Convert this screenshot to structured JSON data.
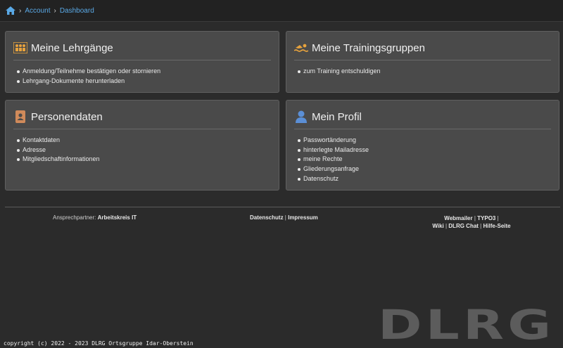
{
  "breadcrumb": {
    "items": [
      "Account",
      "Dashboard"
    ]
  },
  "cards": [
    {
      "title": "Meine Lehrgänge",
      "icon": "group-icon",
      "items": [
        "Anmeldung/Teilnehme bestätigen oder stornieren",
        "Lehrgang-Dokumente herunterladen"
      ]
    },
    {
      "title": "Meine Trainingsgruppen",
      "icon": "swimmer-icon",
      "items": [
        "zum Training entschuldigen"
      ]
    },
    {
      "title": "Personendaten",
      "icon": "address-book-icon",
      "items": [
        "Kontaktdaten",
        "Adresse",
        "Mitgliedschaftinformationen"
      ]
    },
    {
      "title": "Mein Profil",
      "icon": "user-icon",
      "items": [
        "Passwortänderung",
        "hinterlegte Mailadresse",
        "meine Rechte",
        "Gliederungsanfrage",
        "Datenschutz"
      ]
    }
  ],
  "footer": {
    "contact_label": "Ansprechpartner:",
    "contact_name": "Arbeitskreis IT",
    "datenschutz": "Datenschutz",
    "impressum": "Impressum",
    "links": [
      "Webmailer",
      "TYPO3",
      "Wiki",
      "DLRG Chat",
      "Hilfe-Seite"
    ]
  },
  "watermark": "DLRG",
  "copyright": "copyright (c) 2022 - 2023 DLRG Ortsgruppe Idar-Oberstein",
  "colors": {
    "accent": "#5aa9e6",
    "orange": "#e8a33d",
    "brown": "#d08a5a",
    "blue": "#5b8fd6"
  }
}
